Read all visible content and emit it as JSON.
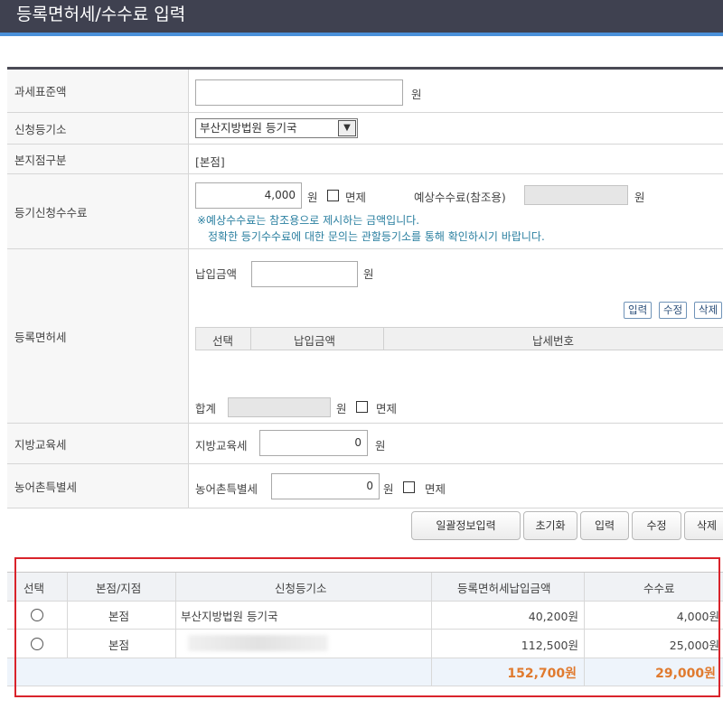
{
  "header": {
    "title": "등록면허세/수수료 입력"
  },
  "form": {
    "tax_base": {
      "label": "과세표준액",
      "value": "",
      "unit": "원"
    },
    "registry": {
      "label": "신청등기소",
      "selected": "부산지방법원 등기국"
    },
    "branch_type": {
      "label": "본지점구분",
      "value": "[본점]"
    },
    "fee": {
      "label": "등기신청수수료",
      "value": "4,000",
      "unit": "원",
      "exempt_label": "면제",
      "expected_label": "예상수수료(참조용)",
      "expected_value": "",
      "expected_unit": "원",
      "note1": "※예상수수료는 참조용으로 제시하는 금액입니다.",
      "note2": "정확한 등기수수료에 대한 문의는 관할등기소를 통해 확인하시기 바랍니다."
    },
    "license_tax": {
      "label": "등록면허세",
      "pay_label": "납입금액",
      "pay_value": "",
      "unit": "원",
      "buttons": {
        "input": "입력",
        "edit": "수정",
        "delete": "삭제"
      },
      "columns": [
        "선택",
        "납입금액",
        "납세번호"
      ],
      "sum_label": "합계",
      "sum_value": "",
      "sum_unit": "원",
      "exempt_label": "면제"
    },
    "edu_tax": {
      "label": "지방교육세",
      "field_label": "지방교육세",
      "value": "0",
      "unit": "원"
    },
    "rural_tax": {
      "label": "농어촌특별세",
      "field_label": "농어촌특별세",
      "value": "0",
      "unit": "원",
      "exempt_label": "면제"
    }
  },
  "actions": {
    "bulk": "일괄정보입력",
    "reset": "초기화",
    "input": "입력",
    "edit": "수정",
    "delete": "삭제"
  },
  "summary": {
    "columns": [
      "선택",
      "본점/지점",
      "신청등기소",
      "등록면허세납입금액",
      "수수료"
    ],
    "rows": [
      {
        "type": "본점",
        "registry": "부산지방법원 등기국",
        "tax": "40,200원",
        "fee": "4,000원"
      },
      {
        "type": "본점",
        "registry": "",
        "tax": "112,500원",
        "fee": "25,000원"
      }
    ],
    "total_tax": "152,700원",
    "total_fee": "29,000원"
  }
}
